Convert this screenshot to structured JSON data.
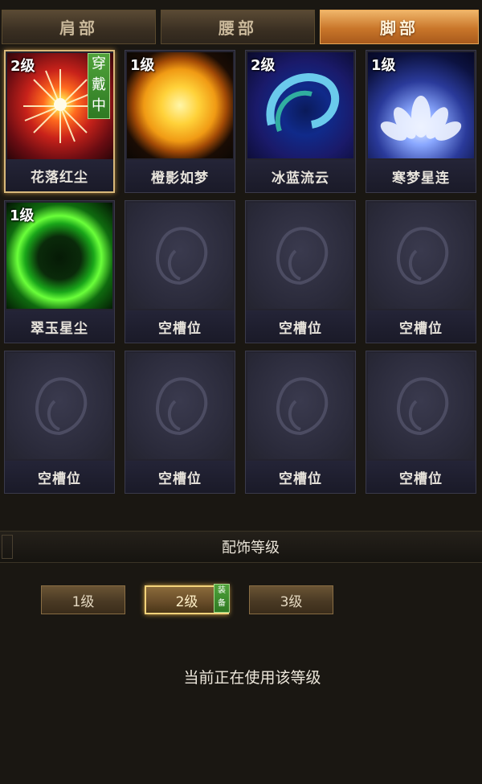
{
  "tabs": [
    {
      "label": "肩部",
      "active": false
    },
    {
      "label": "腰部",
      "active": false
    },
    {
      "label": "脚部",
      "active": true
    }
  ],
  "slots": [
    {
      "label": "花落红尘",
      "level": "2级",
      "wearing": true,
      "badge": "穿戴中",
      "effect": "red-sun-burst",
      "selected": true
    },
    {
      "label": "橙影如梦",
      "level": "1级",
      "wearing": false,
      "effect": "golden-sun"
    },
    {
      "label": "冰蓝流云",
      "level": "2级",
      "wearing": false,
      "effect": "blue-swirl"
    },
    {
      "label": "寒梦星连",
      "level": "1级",
      "wearing": false,
      "effect": "white-lotus"
    },
    {
      "label": "翠玉星尘",
      "level": "1级",
      "wearing": false,
      "effect": "green-ring"
    },
    {
      "label": "空槽位",
      "empty": true
    },
    {
      "label": "空槽位",
      "empty": true
    },
    {
      "label": "空槽位",
      "empty": true
    },
    {
      "label": "空槽位",
      "empty": true
    },
    {
      "label": "空槽位",
      "empty": true
    },
    {
      "label": "空槽位",
      "empty": true
    },
    {
      "label": "空槽位",
      "empty": true
    }
  ],
  "section_title": "配饰等级",
  "level_buttons": [
    {
      "label": "1级",
      "active": false
    },
    {
      "label": "2级",
      "active": true,
      "badge": "装备"
    },
    {
      "label": "3级",
      "active": false
    }
  ],
  "status_text": "当前正在使用该等级"
}
